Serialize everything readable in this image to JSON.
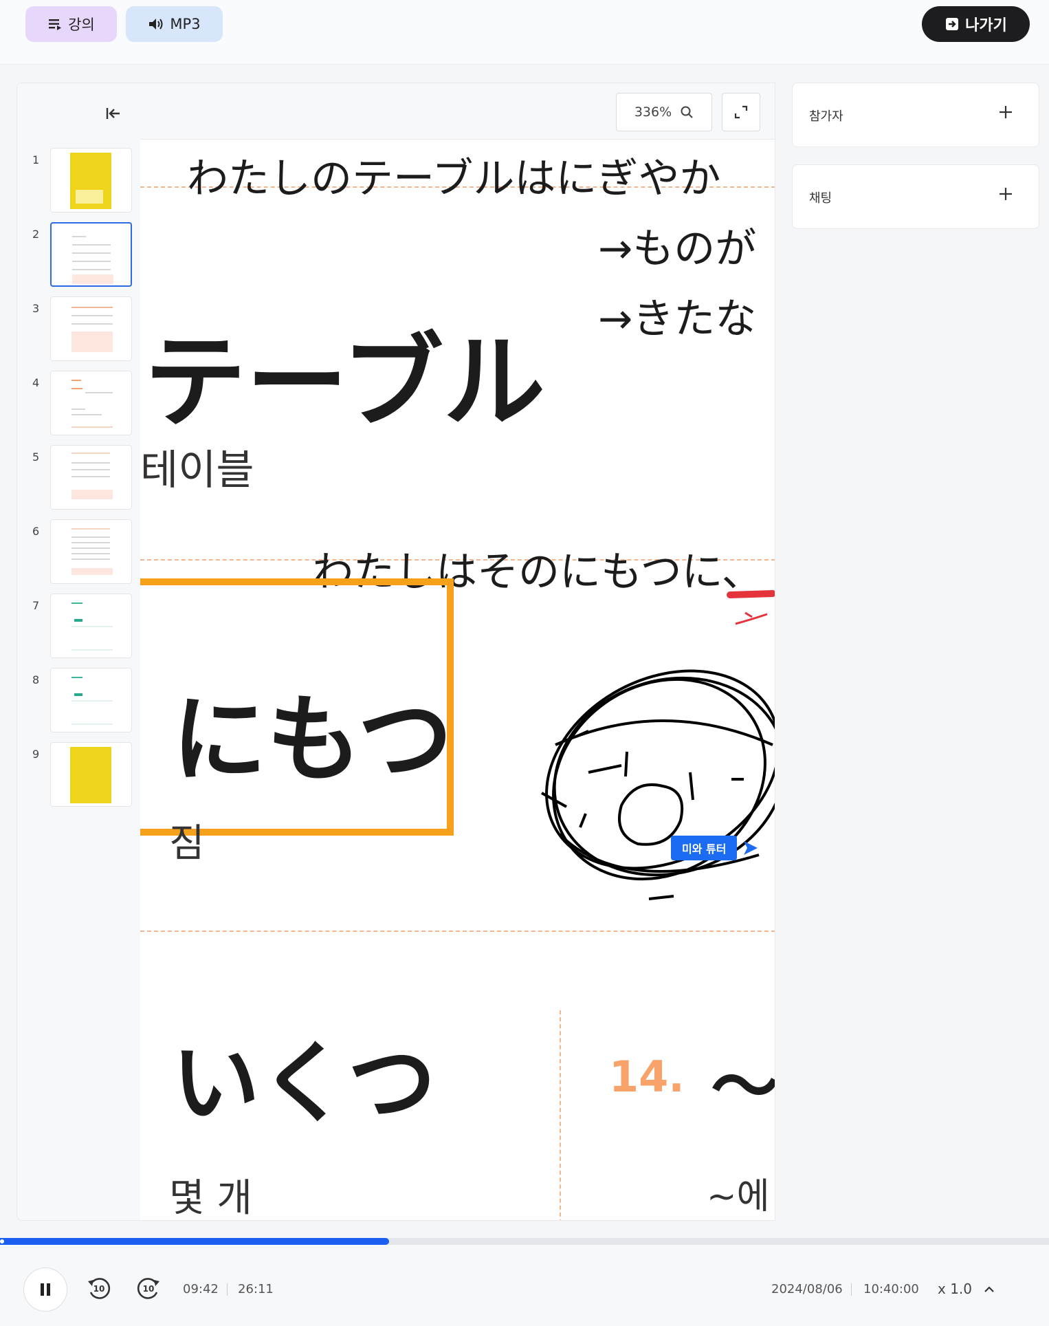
{
  "topbar": {
    "lecture_label": "강의",
    "mp3_label": "MP3",
    "exit_label": "나가기"
  },
  "thumbnails": [
    {
      "num": "1",
      "style": "cover",
      "active": false
    },
    {
      "num": "2",
      "style": "vocab",
      "active": true
    },
    {
      "num": "3",
      "style": "list",
      "active": false
    },
    {
      "num": "4",
      "style": "list",
      "active": false
    },
    {
      "num": "5",
      "style": "table",
      "active": false
    },
    {
      "num": "6",
      "style": "table",
      "active": false
    },
    {
      "num": "7",
      "style": "teal",
      "active": false
    },
    {
      "num": "8",
      "style": "teal",
      "active": false
    },
    {
      "num": "9",
      "style": "end",
      "active": false
    }
  ],
  "viewer": {
    "zoom": "336%"
  },
  "slide": {
    "sentence1": "わたしのテーブルはにぎやか",
    "arrow1": "→ものが",
    "arrow2": "→きたな",
    "word1": "テーブル",
    "word1_ko": "테이블",
    "sentence2": "わたしはそのにもつに、",
    "word2": "にもつ",
    "word2_ko": "짐",
    "word3": "いくつ",
    "word3_ko": "몇 개",
    "number": "14.",
    "tilde": "〜",
    "tilde_ko": "~에",
    "tutor_cursor": "미와 튜터"
  },
  "side_panels": {
    "participants": "참가자",
    "chat": "채팅"
  },
  "player": {
    "current_time": "09:42",
    "total_time": "26:11",
    "progress": 0.371,
    "skip_back": "10",
    "skip_forward": "10",
    "date": "2024/08/06",
    "clock": "10:40:00",
    "speed": "x 1.0"
  },
  "colors": {
    "accent": "#1b5ff0",
    "highlight_box": "#f6a01b",
    "number_orange": "#f7a36a"
  }
}
